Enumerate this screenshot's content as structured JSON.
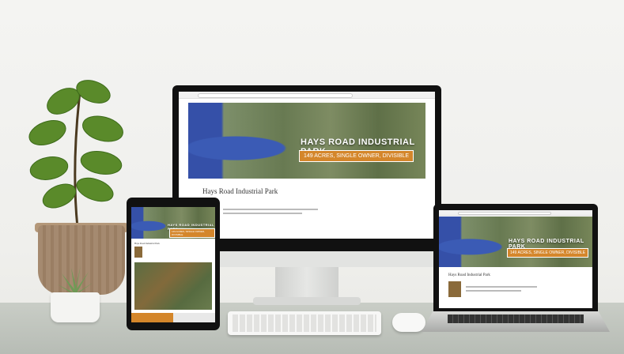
{
  "page": {
    "title": "HAYS ROAD INDUSTRIAL PARK",
    "subtitle": "149 ACRES, SINGLE OWNER, DIVISIBLE",
    "heading": "Hays Road Industrial Park"
  },
  "colors": {
    "accent": "#d4862b",
    "water": "#3550a8"
  },
  "icons": [
    "leaf-icon",
    "succulent-icon"
  ]
}
